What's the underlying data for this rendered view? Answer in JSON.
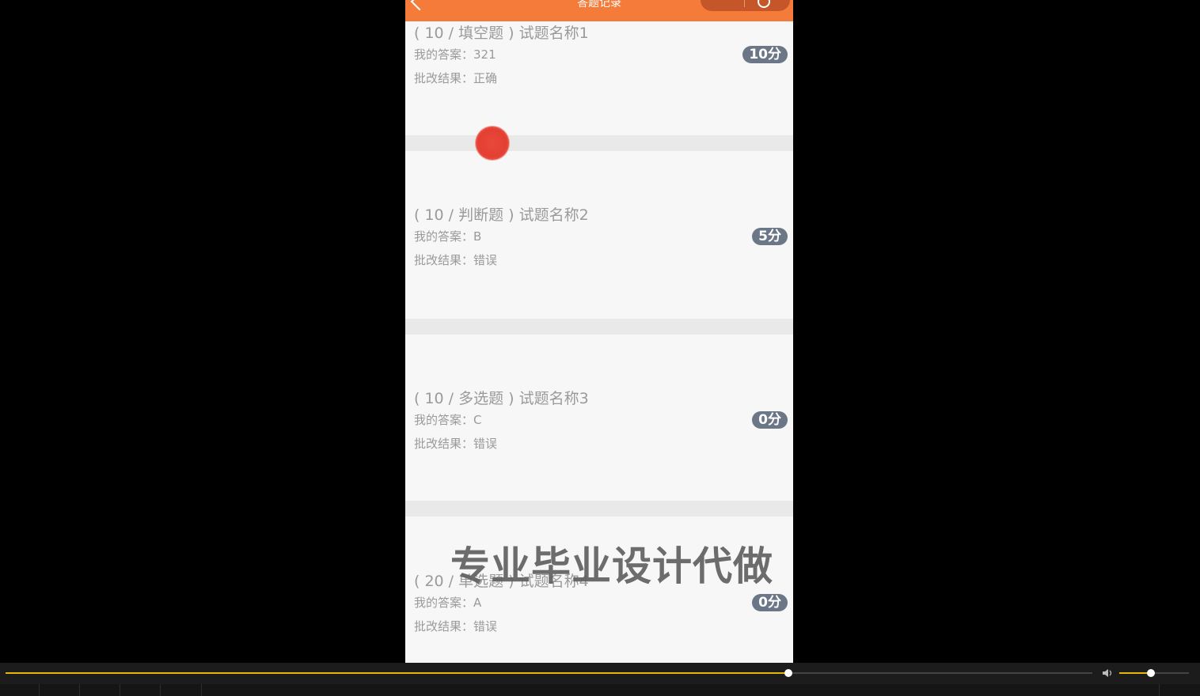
{
  "topbar": {
    "title": "答题记录"
  },
  "questions": [
    {
      "title": "( 10 / 填空题 ) 试题名称1",
      "answer_label": "我的答案：321",
      "result_label": "批改结果：正确",
      "score": "10分"
    },
    {
      "title": "( 10 / 判断题 ) 试题名称2",
      "answer_label": "我的答案：B",
      "result_label": "批改结果：错误",
      "score": "5分"
    },
    {
      "title": "( 10 / 多选题 ) 试题名称3",
      "answer_label": "我的答案：C",
      "result_label": "批改结果：错误",
      "score": "0分"
    },
    {
      "title": "( 20 / 单选题 ) 试题名称4",
      "answer_label": "我的答案：A",
      "result_label": "批改结果：错误",
      "score": "0分"
    }
  ],
  "watermark": "专业毕业设计代做",
  "player": {
    "progress": 0.72,
    "volume": 0.45
  },
  "colors": {
    "accent": "#f47b3a",
    "score_badge": "#6b7686",
    "progress": "#e6b800"
  }
}
